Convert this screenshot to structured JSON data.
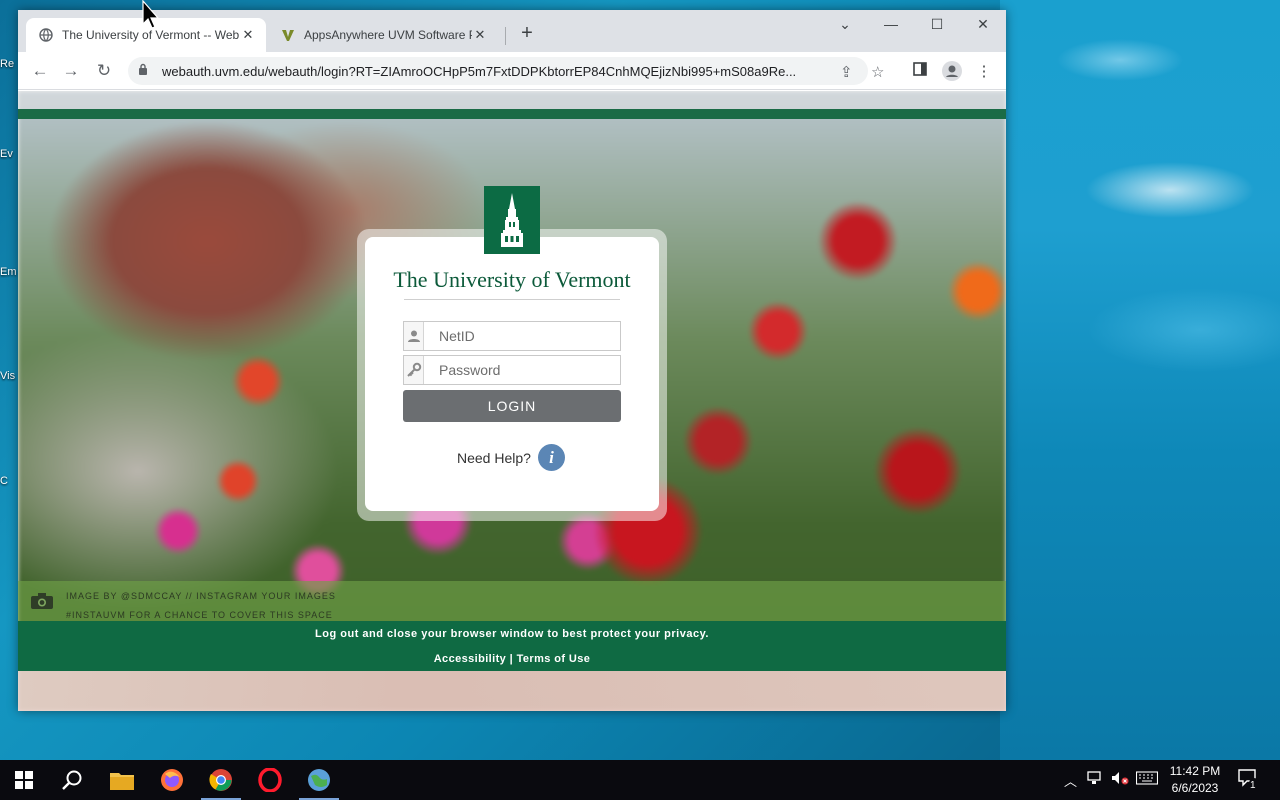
{
  "browser": {
    "tabs": [
      {
        "title": "The University of Vermont -- Web Login",
        "active": true
      },
      {
        "title": "AppsAnywhere UVM Software Portal",
        "active": false
      }
    ],
    "url": "webauth.uvm.edu/webauth/login?RT=ZIAmroOCHpP5m7FxtDDPKbtorrEP84CnhMQEjizNbi995+mS08a9Re..."
  },
  "login": {
    "university_name": "The University of Vermont",
    "netid_placeholder": "NetID",
    "password_placeholder": "Password",
    "login_label": "LOGIN",
    "help_label": "Need Help?"
  },
  "credit": {
    "line1": "IMAGE BY @SDMCCAY // INSTAGRAM YOUR IMAGES",
    "line2": "#INSTAUVM FOR A CHANCE TO COVER THIS SPACE"
  },
  "footer": {
    "privacy_note": "Log out and close your browser window to best protect your privacy.",
    "accessibility_label": "Accessibility",
    "separator": "|",
    "terms_label": "Terms of Use"
  },
  "desktop_icons": [
    {
      "label": "Re"
    },
    {
      "label": "Ev"
    },
    {
      "label": "Em D"
    },
    {
      "label": "Vis"
    },
    {
      "label": "C"
    }
  ],
  "taskbar": {
    "time": "11:42 PM",
    "date": "6/6/2023",
    "notification_count": "1"
  },
  "colors": {
    "uvm_green": "#0f6a43",
    "login_button": "#6b6e71",
    "help_icon": "#5b86b5"
  }
}
